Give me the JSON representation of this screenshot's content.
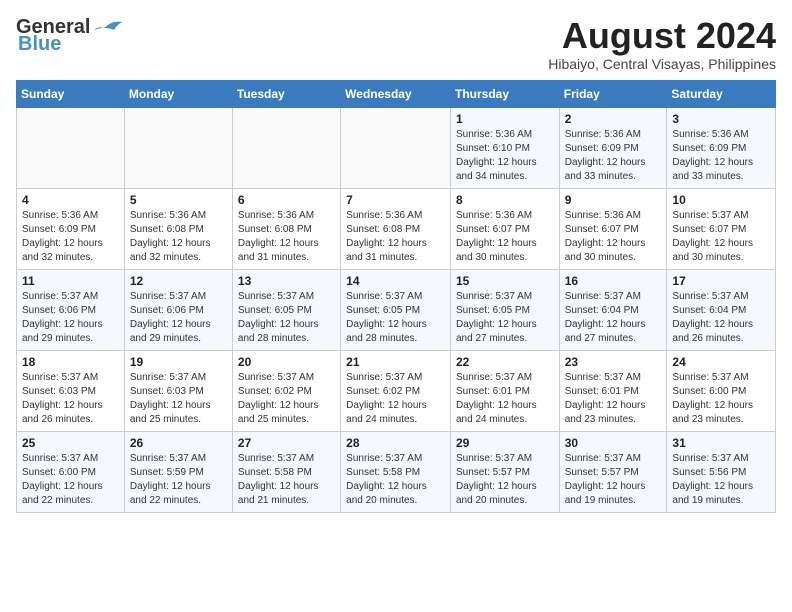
{
  "header": {
    "logo_line1": "General",
    "logo_line2": "Blue",
    "month": "August 2024",
    "location": "Hibaiyo, Central Visayas, Philippines"
  },
  "weekdays": [
    "Sunday",
    "Monday",
    "Tuesday",
    "Wednesday",
    "Thursday",
    "Friday",
    "Saturday"
  ],
  "weeks": [
    [
      {
        "day": "",
        "info": ""
      },
      {
        "day": "",
        "info": ""
      },
      {
        "day": "",
        "info": ""
      },
      {
        "day": "",
        "info": ""
      },
      {
        "day": "1",
        "info": "Sunrise: 5:36 AM\nSunset: 6:10 PM\nDaylight: 12 hours\nand 34 minutes."
      },
      {
        "day": "2",
        "info": "Sunrise: 5:36 AM\nSunset: 6:09 PM\nDaylight: 12 hours\nand 33 minutes."
      },
      {
        "day": "3",
        "info": "Sunrise: 5:36 AM\nSunset: 6:09 PM\nDaylight: 12 hours\nand 33 minutes."
      }
    ],
    [
      {
        "day": "4",
        "info": "Sunrise: 5:36 AM\nSunset: 6:09 PM\nDaylight: 12 hours\nand 32 minutes."
      },
      {
        "day": "5",
        "info": "Sunrise: 5:36 AM\nSunset: 6:08 PM\nDaylight: 12 hours\nand 32 minutes."
      },
      {
        "day": "6",
        "info": "Sunrise: 5:36 AM\nSunset: 6:08 PM\nDaylight: 12 hours\nand 31 minutes."
      },
      {
        "day": "7",
        "info": "Sunrise: 5:36 AM\nSunset: 6:08 PM\nDaylight: 12 hours\nand 31 minutes."
      },
      {
        "day": "8",
        "info": "Sunrise: 5:36 AM\nSunset: 6:07 PM\nDaylight: 12 hours\nand 30 minutes."
      },
      {
        "day": "9",
        "info": "Sunrise: 5:36 AM\nSunset: 6:07 PM\nDaylight: 12 hours\nand 30 minutes."
      },
      {
        "day": "10",
        "info": "Sunrise: 5:37 AM\nSunset: 6:07 PM\nDaylight: 12 hours\nand 30 minutes."
      }
    ],
    [
      {
        "day": "11",
        "info": "Sunrise: 5:37 AM\nSunset: 6:06 PM\nDaylight: 12 hours\nand 29 minutes."
      },
      {
        "day": "12",
        "info": "Sunrise: 5:37 AM\nSunset: 6:06 PM\nDaylight: 12 hours\nand 29 minutes."
      },
      {
        "day": "13",
        "info": "Sunrise: 5:37 AM\nSunset: 6:05 PM\nDaylight: 12 hours\nand 28 minutes."
      },
      {
        "day": "14",
        "info": "Sunrise: 5:37 AM\nSunset: 6:05 PM\nDaylight: 12 hours\nand 28 minutes."
      },
      {
        "day": "15",
        "info": "Sunrise: 5:37 AM\nSunset: 6:05 PM\nDaylight: 12 hours\nand 27 minutes."
      },
      {
        "day": "16",
        "info": "Sunrise: 5:37 AM\nSunset: 6:04 PM\nDaylight: 12 hours\nand 27 minutes."
      },
      {
        "day": "17",
        "info": "Sunrise: 5:37 AM\nSunset: 6:04 PM\nDaylight: 12 hours\nand 26 minutes."
      }
    ],
    [
      {
        "day": "18",
        "info": "Sunrise: 5:37 AM\nSunset: 6:03 PM\nDaylight: 12 hours\nand 26 minutes."
      },
      {
        "day": "19",
        "info": "Sunrise: 5:37 AM\nSunset: 6:03 PM\nDaylight: 12 hours\nand 25 minutes."
      },
      {
        "day": "20",
        "info": "Sunrise: 5:37 AM\nSunset: 6:02 PM\nDaylight: 12 hours\nand 25 minutes."
      },
      {
        "day": "21",
        "info": "Sunrise: 5:37 AM\nSunset: 6:02 PM\nDaylight: 12 hours\nand 24 minutes."
      },
      {
        "day": "22",
        "info": "Sunrise: 5:37 AM\nSunset: 6:01 PM\nDaylight: 12 hours\nand 24 minutes."
      },
      {
        "day": "23",
        "info": "Sunrise: 5:37 AM\nSunset: 6:01 PM\nDaylight: 12 hours\nand 23 minutes."
      },
      {
        "day": "24",
        "info": "Sunrise: 5:37 AM\nSunset: 6:00 PM\nDaylight: 12 hours\nand 23 minutes."
      }
    ],
    [
      {
        "day": "25",
        "info": "Sunrise: 5:37 AM\nSunset: 6:00 PM\nDaylight: 12 hours\nand 22 minutes."
      },
      {
        "day": "26",
        "info": "Sunrise: 5:37 AM\nSunset: 5:59 PM\nDaylight: 12 hours\nand 22 minutes."
      },
      {
        "day": "27",
        "info": "Sunrise: 5:37 AM\nSunset: 5:58 PM\nDaylight: 12 hours\nand 21 minutes."
      },
      {
        "day": "28",
        "info": "Sunrise: 5:37 AM\nSunset: 5:58 PM\nDaylight: 12 hours\nand 20 minutes."
      },
      {
        "day": "29",
        "info": "Sunrise: 5:37 AM\nSunset: 5:57 PM\nDaylight: 12 hours\nand 20 minutes."
      },
      {
        "day": "30",
        "info": "Sunrise: 5:37 AM\nSunset: 5:57 PM\nDaylight: 12 hours\nand 19 minutes."
      },
      {
        "day": "31",
        "info": "Sunrise: 5:37 AM\nSunset: 5:56 PM\nDaylight: 12 hours\nand 19 minutes."
      }
    ]
  ]
}
